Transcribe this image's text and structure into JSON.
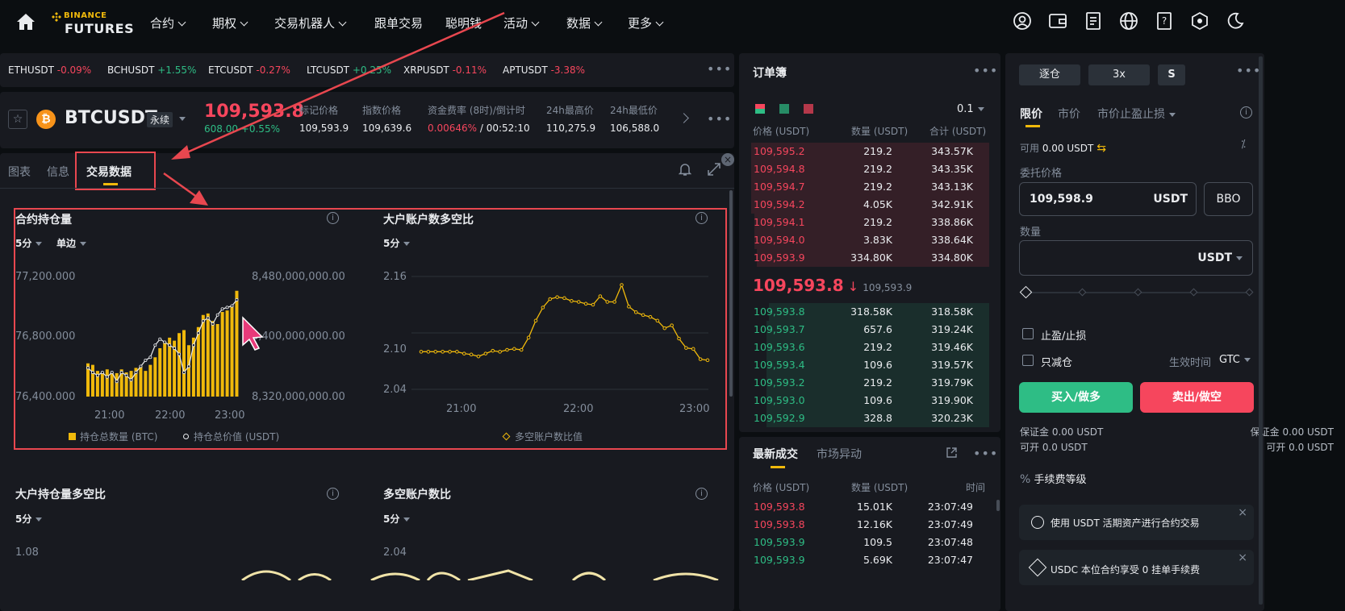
{
  "nav": {
    "logo_top": "BINANCE",
    "logo_bottom": "FUTURES",
    "items": [
      "合约",
      "期权",
      "交易机器人",
      "跟单交易",
      "聪明钱",
      "活动",
      "数据",
      "更多"
    ]
  },
  "tickers": [
    {
      "sym": "ETHUSDT",
      "chg": "-0.09%"
    },
    {
      "sym": "BCHUSDT",
      "chg": "+1.55%"
    },
    {
      "sym": "ETCUSDT",
      "chg": "-0.27%"
    },
    {
      "sym": "LTCUSDT",
      "chg": "+0.25%"
    },
    {
      "sym": "XRPUSDT",
      "chg": "-0.11%"
    },
    {
      "sym": "APTUSDT",
      "chg": "-3.38%"
    }
  ],
  "symbol": {
    "name": "BTCUSDT",
    "type": "永续",
    "price": "109,593.8",
    "change": "608.00 +0.55%",
    "stats": [
      {
        "label": "标记价格",
        "value": "109,593.9"
      },
      {
        "label": "指数价格",
        "value": "109,639.6"
      },
      {
        "label": "资金费率 (8时)/倒计时",
        "value_red": "0.00646%",
        "value_rest": " / 00:52:10"
      },
      {
        "label": "24h最高价",
        "value": "110,275.9"
      },
      {
        "label": "24h最低价",
        "value": "106,588.0"
      }
    ]
  },
  "tabs": [
    "图表",
    "信息",
    "交易数据"
  ],
  "charts": {
    "oi": {
      "title": "合约持仓量",
      "period": "5分",
      "mode": "单边",
      "left_ticks": [
        "77,200.000",
        "76,800.000",
        "76,400.000"
      ],
      "right_ticks": [
        "8,480,000,000.00",
        "8,400,000,000.00",
        "8,320,000,000.00"
      ],
      "x_ticks": [
        "21:00",
        "22:00",
        "23:00"
      ],
      "legend1": "持仓总数量 (BTC)",
      "legend2": "持仓总价值 (USDT)"
    },
    "ratio": {
      "title": "大户账户数多空比",
      "period": "5分",
      "y_ticks": [
        "2.16",
        "2.10",
        "2.04"
      ],
      "x_ticks": [
        "21:00",
        "22:00",
        "23:00"
      ],
      "legend": "多空账户数比值"
    },
    "pos": {
      "title": "大户持仓量多空比",
      "period": "5分",
      "y_tick": "1.08"
    },
    "acct": {
      "title": "多空账户数比",
      "period": "5分",
      "y_tick": "2.04"
    }
  },
  "chart_data": [
    {
      "type": "bar",
      "title": "合约持仓量",
      "series": [
        {
          "name": "持仓总数量 (BTC)",
          "values": [
            76620,
            76610,
            76570,
            76560,
            76580,
            76560,
            76555,
            76580,
            76560,
            76570,
            76590,
            76600,
            76570,
            76610,
            76660,
            76720,
            76760,
            76790,
            76770,
            76820,
            76840,
            76740,
            76790,
            76860,
            76940,
            76950,
            76900,
            76880,
            76960,
            76970,
            77000,
            77100
          ]
        },
        {
          "name": "持仓总价值 (USDT)",
          "values": [
            76590,
            76560,
            76540,
            76560,
            76530,
            76560,
            76500,
            76560,
            76540,
            76510,
            76560,
            76600,
            76640,
            76660,
            76740,
            76780,
            76760,
            76740,
            76720,
            76680,
            76560,
            76600,
            76740,
            76820,
            76900,
            76920,
            76880,
            76940,
            76980,
            76990,
            77000,
            77040
          ]
        }
      ],
      "xlabel": "",
      "ylabel": ""
    },
    {
      "type": "line",
      "title": "大户账户数多空比",
      "series": [
        {
          "name": "多空账户数比值",
          "values": [
            2.08,
            2.08,
            2.08,
            2.08,
            2.08,
            2.08,
            2.078,
            2.077,
            2.075,
            2.078,
            2.081,
            2.08,
            2.082,
            2.083,
            2.082,
            2.095,
            2.113,
            2.127,
            2.136,
            2.138,
            2.137,
            2.134,
            2.133,
            2.131,
            2.13,
            2.139,
            2.133,
            2.133,
            2.151,
            2.128,
            2.122,
            2.119,
            2.117,
            2.113,
            2.105,
            2.108,
            2.094,
            2.084,
            2.083,
            2.072,
            2.071
          ]
        }
      ],
      "ylim": [
        2.04,
        2.16
      ]
    }
  ],
  "orderbook": {
    "title": "订单簿",
    "tick": "0.1",
    "headers": [
      "价格 (USDT)",
      "数量 (USDT)",
      "合计 (USDT)"
    ],
    "asks": [
      [
        "109,595.2",
        "219.2",
        "343.57K",
        0.95
      ],
      [
        "109,594.8",
        "219.2",
        "343.35K",
        0.95
      ],
      [
        "109,594.7",
        "219.2",
        "343.13K",
        0.95
      ],
      [
        "109,594.2",
        "4.05K",
        "342.91K",
        0.95
      ],
      [
        "109,594.1",
        "219.2",
        "338.86K",
        0.94
      ],
      [
        "109,594.0",
        "3.83K",
        "338.64K",
        0.94
      ],
      [
        "109,593.9",
        "334.80K",
        "334.80K",
        0.93
      ]
    ],
    "mid_price": "109,593.8",
    "mid_arrow": "↓",
    "mid_mark": "109,593.9",
    "bids": [
      [
        "109,593.8",
        "318.58K",
        "318.58K",
        0.88
      ],
      [
        "109,593.7",
        "657.6",
        "319.24K",
        0.89
      ],
      [
        "109,593.6",
        "219.2",
        "319.46K",
        0.89
      ],
      [
        "109,593.4",
        "109.6",
        "319.57K",
        0.89
      ],
      [
        "109,593.2",
        "219.2",
        "319.79K",
        0.89
      ],
      [
        "109,593.0",
        "109.6",
        "319.90K",
        0.89
      ],
      [
        "109,592.9",
        "328.8",
        "320.23K",
        0.89
      ]
    ]
  },
  "trades": {
    "tab1": "最新成交",
    "tab2": "市场异动",
    "headers": [
      "价格 (USDT)",
      "数量 (USDT)",
      "时间"
    ],
    "rows": [
      [
        "109,593.8",
        "15.01K",
        "23:07:49",
        "red"
      ],
      [
        "109,593.8",
        "12.16K",
        "23:07:49",
        "red"
      ],
      [
        "109,593.9",
        "109.5",
        "23:07:48",
        "green"
      ],
      [
        "109,593.9",
        "5.69K",
        "23:07:47",
        "green"
      ]
    ]
  },
  "order": {
    "margin": "逐仓",
    "leverage": "3x",
    "mode": "S",
    "tab_limit": "限价",
    "tab_market": "市价",
    "tab_stop": "市价止盈止损",
    "avail_label": "可用",
    "avail_value": "0.00 USDT",
    "price_label": "委托价格",
    "price_value": "109,598.9",
    "price_unit": "USDT",
    "bbo": "BBO",
    "qty_label": "数量",
    "qty_unit": "USDT",
    "tpsl": "止盈/止损",
    "reduce": "只减仓",
    "tif_label": "生效时间",
    "tif_value": "GTC",
    "buy": "买入/做多",
    "sell": "卖出/做空",
    "margin_l": "保证金 0.00 USDT",
    "margin_r": "保证金 0.00 USDT",
    "open_l": "可开 0.0 USDT",
    "open_r": "可开 0.0 USDT",
    "fee": "手续费等级",
    "promo1": "使用 USDT 活期资产进行合约交易",
    "promo2": "USDC 本位合约享受 0 挂单手续费"
  },
  "colors": {
    "accent": "#f0b90b",
    "red": "#f6465d",
    "green": "#2ebd85",
    "annotation": "#e8474f"
  }
}
